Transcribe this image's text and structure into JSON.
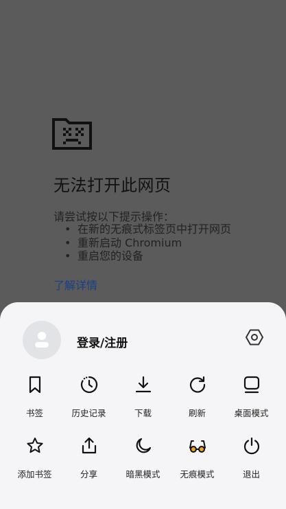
{
  "error_page": {
    "title": "无法打开此网页",
    "intro": "请尝试按以下提示操作：",
    "suggestions": [
      "在新的无痕式标签页中打开网页",
      "重新启动 Chromium",
      "重启您的设备"
    ],
    "learn_more": "了解详情"
  },
  "menu": {
    "login_label": "登录/注册",
    "row1": [
      {
        "label": "书签",
        "icon": "bookmark-icon"
      },
      {
        "label": "历史记录",
        "icon": "history-icon"
      },
      {
        "label": "下载",
        "icon": "download-icon"
      },
      {
        "label": "刷新",
        "icon": "refresh-icon"
      },
      {
        "label": "桌面模式",
        "icon": "desktop-mode-icon"
      }
    ],
    "row2": [
      {
        "label": "添加书签",
        "icon": "star-icon"
      },
      {
        "label": "分享",
        "icon": "share-icon"
      },
      {
        "label": "暗黑模式",
        "icon": "moon-icon"
      },
      {
        "label": "无痕模式",
        "icon": "incognito-glasses-icon"
      },
      {
        "label": "退出",
        "icon": "power-icon"
      }
    ]
  },
  "colors": {
    "sheet_background": "#f5f5f7",
    "overlay": "#5b5b5b",
    "link": "#1a3f86",
    "incognito_accent": "#f0a020"
  }
}
